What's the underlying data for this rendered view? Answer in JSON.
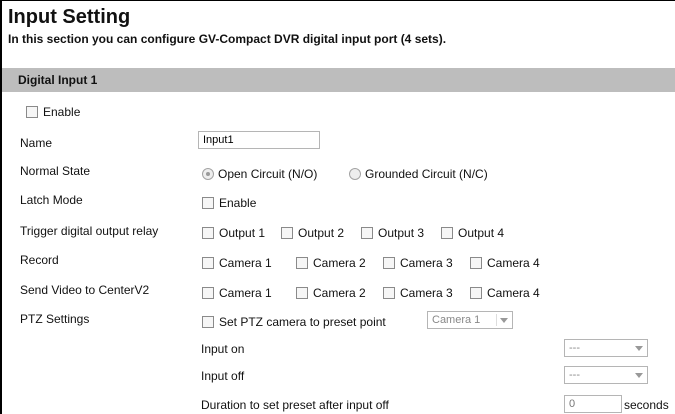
{
  "header": {
    "title": "Input Setting",
    "subtitle": "In this section you can configure GV-Compact DVR digital input port (4 sets)."
  },
  "section": {
    "title": "Digital Input 1"
  },
  "enable": {
    "label": "Enable",
    "checked": false
  },
  "name": {
    "label": "Name",
    "value": "Input1"
  },
  "normal_state": {
    "label": "Normal State",
    "options": [
      "Open Circuit (N/O)",
      "Grounded Circuit (N/C)"
    ],
    "selected": "Open Circuit (N/O)"
  },
  "latch_mode": {
    "label": "Latch Mode",
    "option": "Enable"
  },
  "trigger": {
    "label": "Trigger digital output relay",
    "options": [
      "Output 1",
      "Output 2",
      "Output 3",
      "Output 4"
    ]
  },
  "record": {
    "label": "Record",
    "options": [
      "Camera 1",
      "Camera 2",
      "Camera 3",
      "Camera 4"
    ]
  },
  "send_video": {
    "label": "Send Video to CenterV2",
    "options": [
      "Camera 1",
      "Camera 2",
      "Camera 3",
      "Camera 4"
    ]
  },
  "ptz": {
    "label": "PTZ Settings",
    "preset_label": "Set PTZ camera to preset point",
    "camera_select": "Camera 1",
    "input_on_label": "Input on",
    "input_on_value": "---",
    "input_off_label": "Input off",
    "input_off_value": "---",
    "duration_label": "Duration to set preset after input off",
    "duration_value": "0",
    "duration_unit": "seconds"
  }
}
